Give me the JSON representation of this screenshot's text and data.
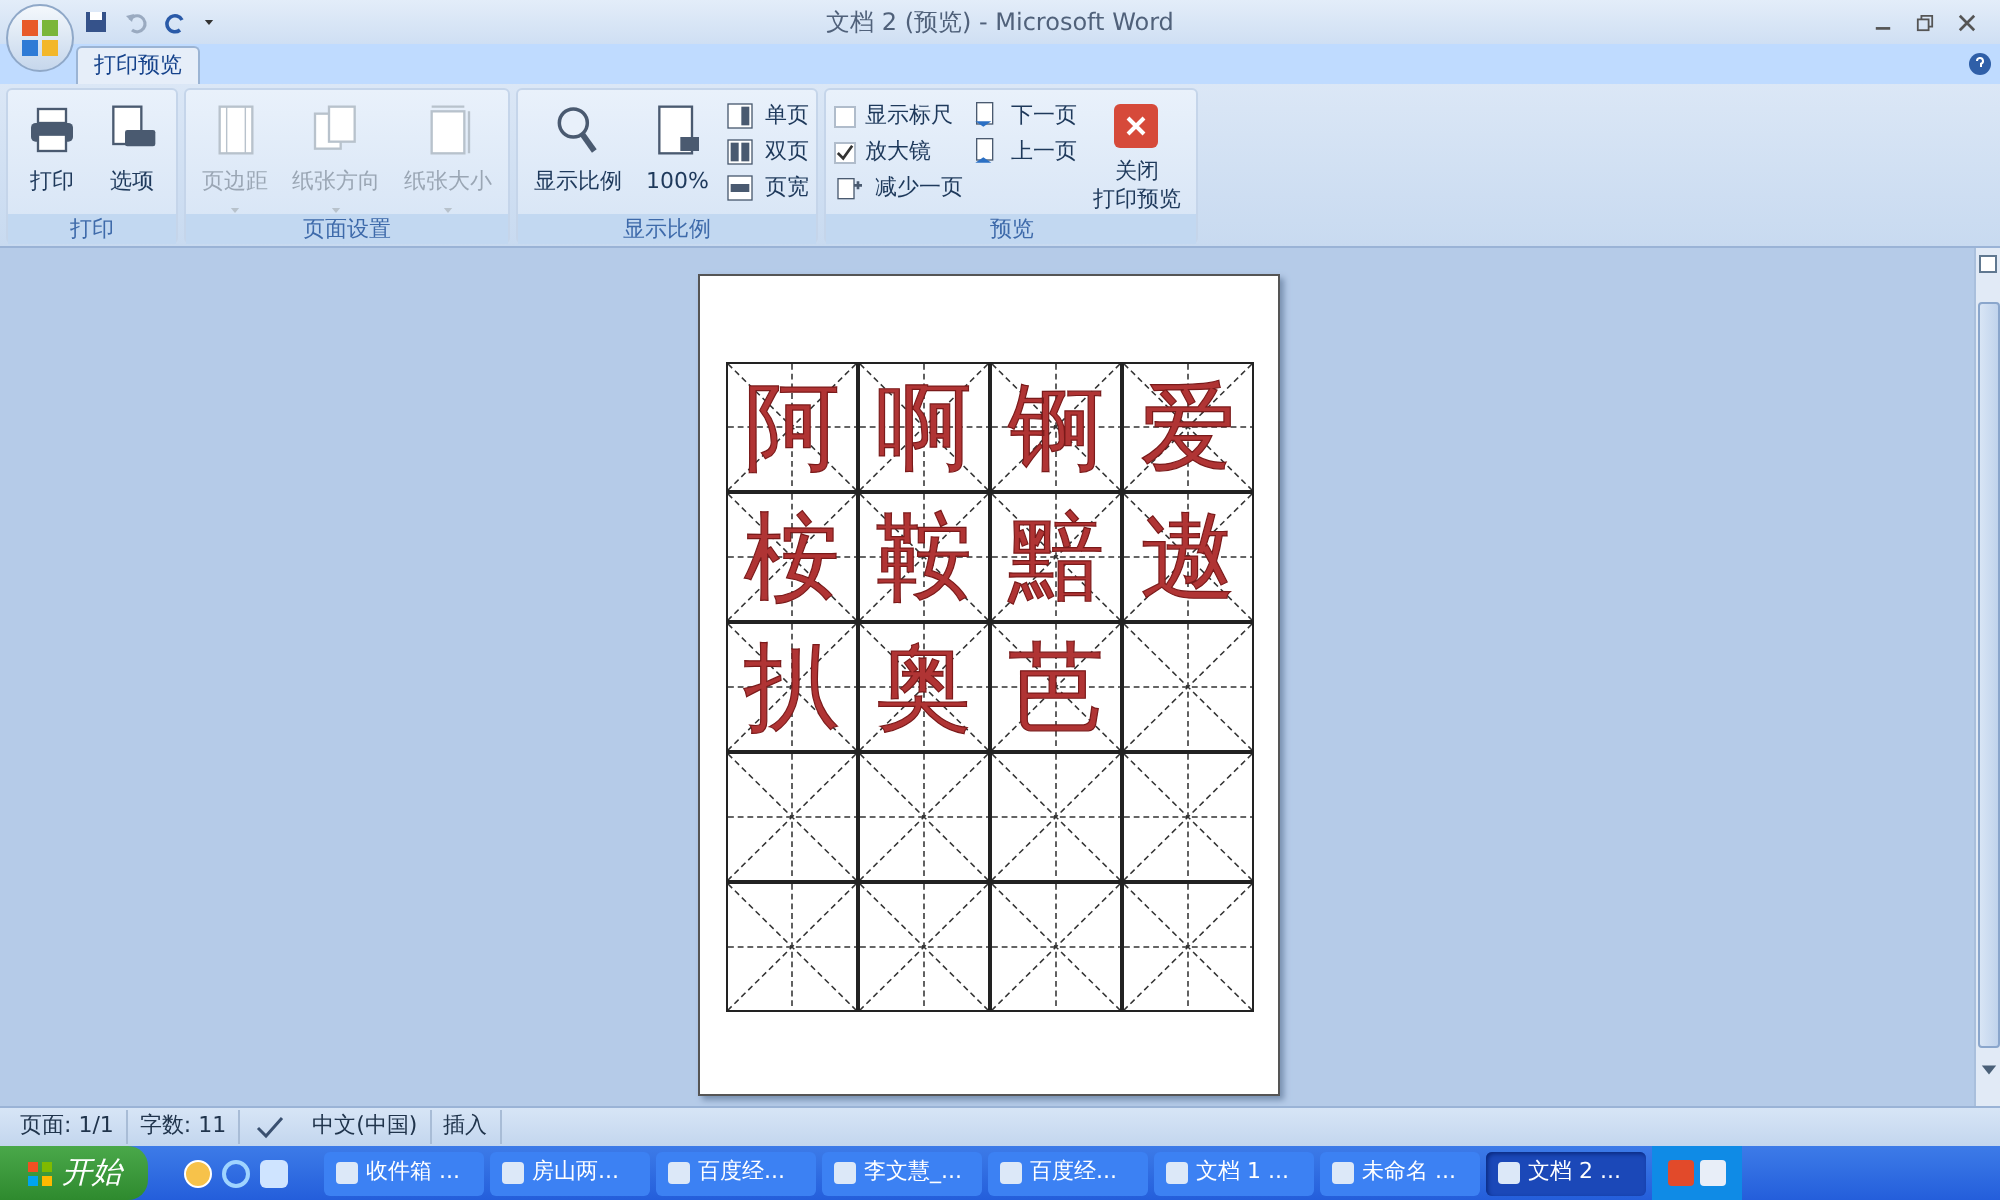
{
  "window": {
    "title": "文档 2 (预览) - Microsoft Word"
  },
  "tabs": [
    {
      "label": "打印预览",
      "selected": true
    }
  ],
  "ribbon": [
    {
      "title": "打印",
      "items": [
        {
          "kind": "large",
          "label": "打印",
          "disabled": false
        },
        {
          "kind": "large",
          "label": "选项",
          "disabled": false
        }
      ]
    },
    {
      "title": "页面设置",
      "items": [
        {
          "kind": "dropdown",
          "label": "页边距",
          "disabled": true
        },
        {
          "kind": "dropdown",
          "label": "纸张方向",
          "disabled": true
        },
        {
          "kind": "dropdown",
          "label": "纸张大小",
          "disabled": true
        }
      ]
    },
    {
      "title": "显示比例",
      "items": [
        {
          "kind": "large",
          "label": "显示比例",
          "disabled": false
        },
        {
          "kind": "large",
          "label": "100%",
          "disabled": false
        },
        {
          "kind": "small",
          "label": "单页",
          "disabled": false
        },
        {
          "kind": "small",
          "label": "双页",
          "disabled": false
        },
        {
          "kind": "small",
          "label": "页宽",
          "disabled": false
        }
      ]
    },
    {
      "title": "预览",
      "items": [
        {
          "kind": "check",
          "label": "显示标尺",
          "checked": false,
          "disabled": false
        },
        {
          "kind": "check",
          "label": "放大镜",
          "checked": true,
          "disabled": false
        },
        {
          "kind": "small",
          "label": "减少一页",
          "disabled": false
        },
        {
          "kind": "small",
          "label": "下一页",
          "disabled": false
        },
        {
          "kind": "small",
          "label": "上一页",
          "disabled": false
        },
        {
          "kind": "close",
          "label": "关闭",
          "label_2": "打印预览",
          "disabled": false
        }
      ]
    }
  ],
  "practice_sheet": {
    "rows": [
      [
        "阿",
        "啊",
        "锕",
        "爱"
      ],
      [
        "桉",
        "鞍",
        "黯",
        "遨"
      ],
      [
        "扒",
        "奥",
        "芭"
      ]
    ]
  },
  "status_bar": [
    "页面: 1/1",
    "字数: 11",
    "中文(中国)",
    "插入"
  ],
  "taskbar": {
    "start": "开始",
    "tasks": [
      {
        "label": "收件箱 ...",
        "selected": false
      },
      {
        "label": "房山两...",
        "selected": false
      },
      {
        "label": "百度经...",
        "selected": false
      },
      {
        "label": "李文慧_...",
        "selected": false
      },
      {
        "label": "百度经...",
        "selected": false
      },
      {
        "label": "文档 1 ...",
        "selected": false
      },
      {
        "label": "未命名 ...",
        "selected": false
      },
      {
        "label": "文档 2 ...",
        "selected": true
      }
    ]
  }
}
